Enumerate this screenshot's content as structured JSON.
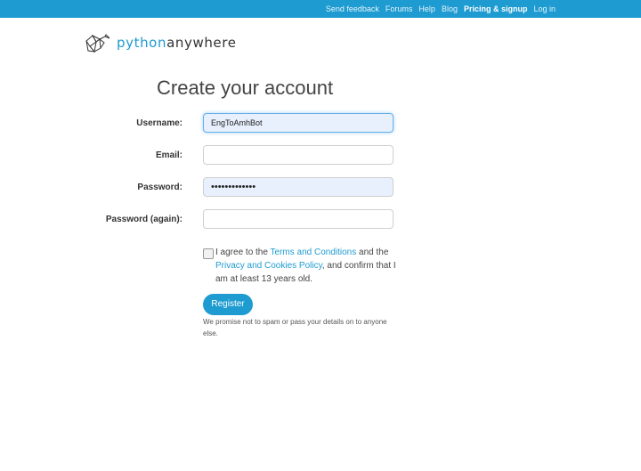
{
  "nav": {
    "send_feedback": "Send feedback",
    "forums": "Forums",
    "help": "Help",
    "blog": "Blog",
    "pricing": "Pricing & signup",
    "login": "Log in"
  },
  "logo": {
    "icon": "snake-geometric-logo-icon",
    "text_a": "python",
    "text_b": "anywhere"
  },
  "page": {
    "title": "Create your account"
  },
  "form": {
    "username_label": "Username:",
    "username_value": "EngToAmhBot",
    "email_label": "Email:",
    "email_value": "",
    "password_label": "Password:",
    "password_value": "•••••••••••••",
    "password2_label": "Password (again):",
    "password2_value": "",
    "terms_prefix": "I agree to the ",
    "terms_link": "Terms and Conditions",
    "terms_mid": " and the ",
    "privacy_link": "Privacy and Cookies Policy",
    "terms_suffix": ", and confirm that I am at least 13 years old.",
    "register_label": "Register",
    "promise": "We promise not to spam or pass your details on to anyone else."
  },
  "colors": {
    "brand": "#1e9bd0",
    "autofill": "#e8f0fe"
  }
}
